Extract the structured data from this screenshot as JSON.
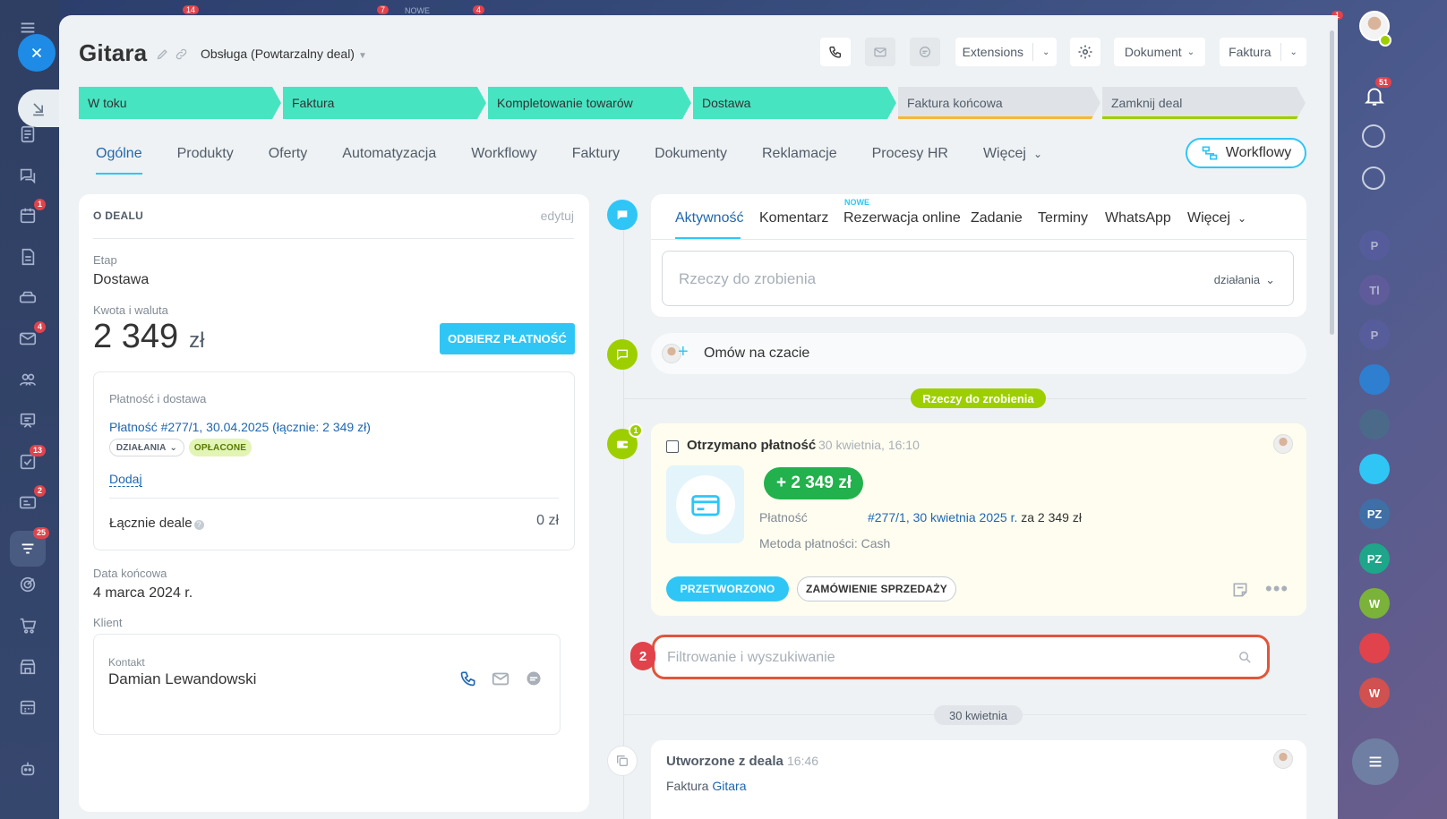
{
  "deal": {
    "title": "Gitara",
    "type": "Obsługa (Powtarzalny deal)"
  },
  "header_buttons": {
    "extensions": "Extensions",
    "document": "Dokument",
    "invoice": "Faktura"
  },
  "stages": [
    {
      "label": "W toku",
      "state": "done"
    },
    {
      "label": "Faktura",
      "state": "done"
    },
    {
      "label": "Kompletowanie towarów",
      "state": "done"
    },
    {
      "label": "Dostawa",
      "state": "done"
    },
    {
      "label": "Faktura końcowa",
      "state": "todo",
      "accent": "#f5b73b"
    },
    {
      "label": "Zamknij deal",
      "state": "todo",
      "accent": "#9dcf00"
    }
  ],
  "tabs": [
    "Ogólne",
    "Produkty",
    "Oferty",
    "Automatyzacja",
    "Workflowy",
    "Faktury",
    "Dokumenty",
    "Reklamacje",
    "Procesy HR",
    "Więcej"
  ],
  "workflow_button": "Workflowy",
  "about": {
    "section_title": "O DEALU",
    "edit_link": "edytuj",
    "stage_label": "Etap",
    "stage_value": "Dostawa",
    "amount_label": "Kwota i waluta",
    "amount_value": "2 349",
    "currency": "zł",
    "receive_payment": "ODBIERZ PŁATNOŚĆ",
    "payment_section": "Płatność i dostawa",
    "payment_link": "Płatność #277/1, 30.04.2025 (łącznie: 2 349 zł)",
    "actions_pill": "DZIAŁANIA",
    "paid_pill": "OPŁACONE",
    "add_link": "Dodaj",
    "total_label": "Łącznie deale",
    "total_value": "0 zł",
    "end_date_label": "Data końcowa",
    "end_date_value": "4 marca 2024 r.",
    "client_label": "Klient",
    "contact_label": "Kontakt",
    "contact_name": "Damian Lewandowski"
  },
  "editor": {
    "tabs": [
      "Aktywność",
      "Komentarz",
      "Rezerwacja online",
      "Zadanie",
      "Terminy",
      "WhatsApp",
      "Więcej"
    ],
    "new_badge": "NOWE",
    "placeholder": "Rzeczy do zrobienia",
    "actions": "działania"
  },
  "chat": {
    "label": "Omów na czacie"
  },
  "todo_chip": "Rzeczy do zrobienia",
  "payment_card": {
    "badge": "1",
    "title": "Otrzymano płatność",
    "time": "30 kwietnia, 16:10",
    "amount": "+ 2 349 zł",
    "payment_label": "Płatność",
    "payment_link": "#277/1, 30 kwietnia 2025 r.",
    "payment_suffix": "za 2 349 zł",
    "method": "Metoda płatności: Cash",
    "processed_btn": "PRZETWORZONO",
    "sales_order_btn": "ZAMÓWIENIE SPRZEDAŻY"
  },
  "search": {
    "step": "2",
    "placeholder": "Filtrowanie i wyszukiwanie"
  },
  "date_chip": "30 kwietnia",
  "created_card": {
    "title": "Utworzone z deala",
    "time": "16:46",
    "prefix": "Faktura",
    "link": "Gitara"
  },
  "left_rail_badges": {
    "calendar": "1",
    "mail": "4",
    "tasks": "13",
    "cards": "2",
    "crm": "25"
  },
  "right_rail": {
    "notifications_badge": "51",
    "avatars": [
      {
        "text": "P",
        "color": "#5b5ea6"
      },
      {
        "text": "Tl",
        "color": "#6c5ba6"
      },
      {
        "text": "P",
        "color": "#5b5ea6"
      },
      {
        "text": "",
        "color": "#2f7fd1"
      },
      {
        "text": "",
        "color": "#4b6a8a"
      },
      {
        "text": "",
        "color": "#2fc6f6"
      },
      {
        "text": "PZ",
        "color": "#3f6fa6"
      },
      {
        "text": "PZ",
        "color": "#1fa58a"
      },
      {
        "text": "W",
        "color": "#7bb33a"
      },
      {
        "text": "",
        "color": "#e0434c"
      },
      {
        "text": "W",
        "color": "#d0514f"
      }
    ]
  },
  "top_counters": {
    "a": "14",
    "b": "7",
    "c": "NOWE",
    "d": "4",
    "e": "1"
  },
  "colors": {
    "accent": "#2fc6f6",
    "stage_done": "#47e4c2",
    "link": "#2067b0",
    "success": "#9dcf00",
    "payment_green": "#22b14c",
    "alert": "#e2553b"
  }
}
